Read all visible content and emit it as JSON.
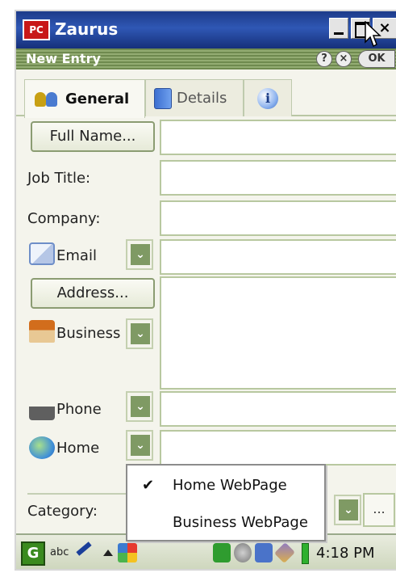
{
  "window": {
    "title": "Zaurus"
  },
  "subbar": {
    "title": "New Entry",
    "help": "?",
    "cancel": "×",
    "ok": "OK"
  },
  "titlebar": {
    "close": "×"
  },
  "tabs": [
    {
      "label": "General",
      "icon": "people-icon",
      "active": true
    },
    {
      "label": "Details",
      "icon": "book-icon",
      "active": false
    },
    {
      "label": "",
      "icon": "info-icon",
      "active": false
    }
  ],
  "form": {
    "full_name_button": "Full Name...",
    "job_title_label": "Job Title:",
    "company_label": "Company:",
    "email_label": "Email",
    "address_button": "Address...",
    "business_label": "Business",
    "phone_label": "Phone",
    "home_label": "Home",
    "category_label": "Category:",
    "more_button": "...",
    "dropdown_arrow": "⌄"
  },
  "popup_menu": {
    "items": [
      {
        "label": "Home WebPage",
        "checked": true,
        "check": "✔"
      },
      {
        "label": "Business WebPage",
        "checked": false,
        "check": ""
      }
    ]
  },
  "taskbar": {
    "abc": "abc",
    "time": "4:18 PM"
  },
  "colors": {
    "titlebar": "#1d3b8a",
    "subbar": "#7a9658",
    "field_border": "#b8c8a0",
    "dropdown_green": "#7f9a64"
  }
}
